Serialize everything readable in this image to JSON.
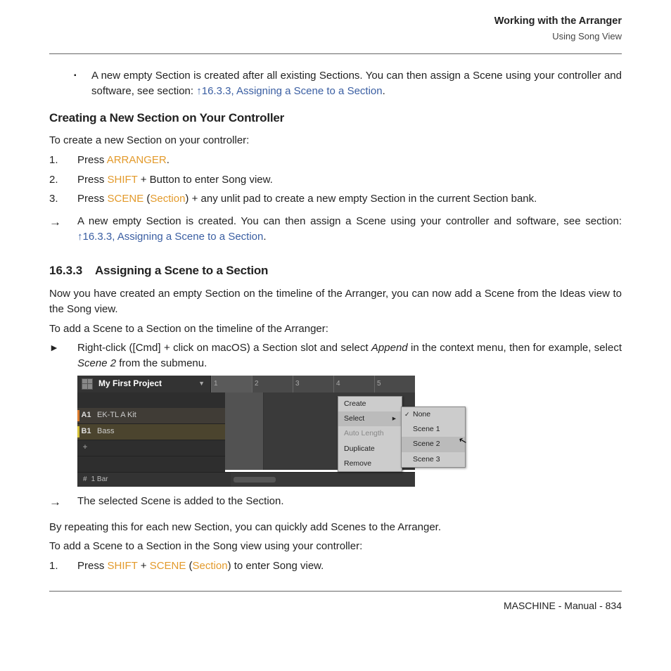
{
  "header": {
    "title": "Working with the Arranger",
    "subtitle": "Using Song View"
  },
  "intro_bullet": {
    "prefix": "A new empty Section is created after all existing Sections. You can then assign a Scene using your controller and software, see section: ",
    "link": "↑16.3.3, Assigning a Scene to a Section",
    "suffix": "."
  },
  "sub1": {
    "heading": "Creating a New Section on Your Controller",
    "lead": "To create a new Section on your controller:",
    "steps": [
      {
        "num": "1.",
        "pre": "Press ",
        "kw": "ARRANGER",
        "post": "."
      },
      {
        "num": "2.",
        "pre": "Press ",
        "kw": "SHIFT",
        "post": " + Button to enter Song view."
      },
      {
        "num": "3.",
        "pre": "Press ",
        "kw": "SCENE",
        "mid": " (",
        "kw2": "Section",
        "post": ") + any unlit pad to create a new empty Section in the current Section bank."
      }
    ],
    "result": {
      "pre": "A new empty Section is created. You can then assign a Scene using your controller and software, see section: ",
      "link": "↑16.3.3, Assigning a Scene to a Section",
      "post": "."
    }
  },
  "sect": {
    "num": "16.3.3",
    "title": "Assigning a Scene to a Section",
    "p1": "Now you have created an empty Section on the timeline of the Arranger, you can now add a Scene from the Ideas view to the Song view.",
    "p2": "To add a Scene to a Section on the timeline of the Arranger:",
    "tri": {
      "pre": "Right-click ([Cmd] + click on macOS) a Section slot and select ",
      "em1": "Append",
      "mid": " in the context menu, then for example, select ",
      "em2": "Scene 2",
      "post": " from the submenu."
    }
  },
  "screenshot": {
    "project": "My First Project",
    "ruler": [
      "1",
      "2",
      "3",
      "4",
      "5"
    ],
    "track_a": {
      "slot": "A1",
      "name": "EK-TL A Kit"
    },
    "track_b": {
      "slot": "B1",
      "name": "Bass"
    },
    "plus": "+",
    "bar_label": "1 Bar",
    "ctx": {
      "items": [
        {
          "label": "Create",
          "state": ""
        },
        {
          "label": "Select",
          "state": "hover",
          "arrow": "▸"
        },
        {
          "label": "Auto Length",
          "state": "disabled"
        },
        {
          "label": "Duplicate",
          "state": ""
        },
        {
          "label": "Remove",
          "state": ""
        }
      ]
    },
    "sub": {
      "items": [
        {
          "label": "None",
          "sel": true
        },
        {
          "label": "Scene 1",
          "sel": false
        },
        {
          "label": "Scene 2",
          "sel": false,
          "hover": true
        },
        {
          "label": "Scene 3",
          "sel": false
        }
      ]
    }
  },
  "after": {
    "result": "The selected Scene is added to the Section.",
    "p1": "By repeating this for each new Section, you can quickly add Scenes to the Arranger.",
    "p2": "To add a Scene to a Section in the Song view using your controller:",
    "step": {
      "num": "1.",
      "pre": "Press ",
      "kw": "SHIFT",
      "mid": " + ",
      "kw2": "SCENE",
      "mid2": " (",
      "kw3": "Section",
      "post": ") to enter Song view."
    }
  },
  "footer": "MASCHINE - Manual - 834"
}
